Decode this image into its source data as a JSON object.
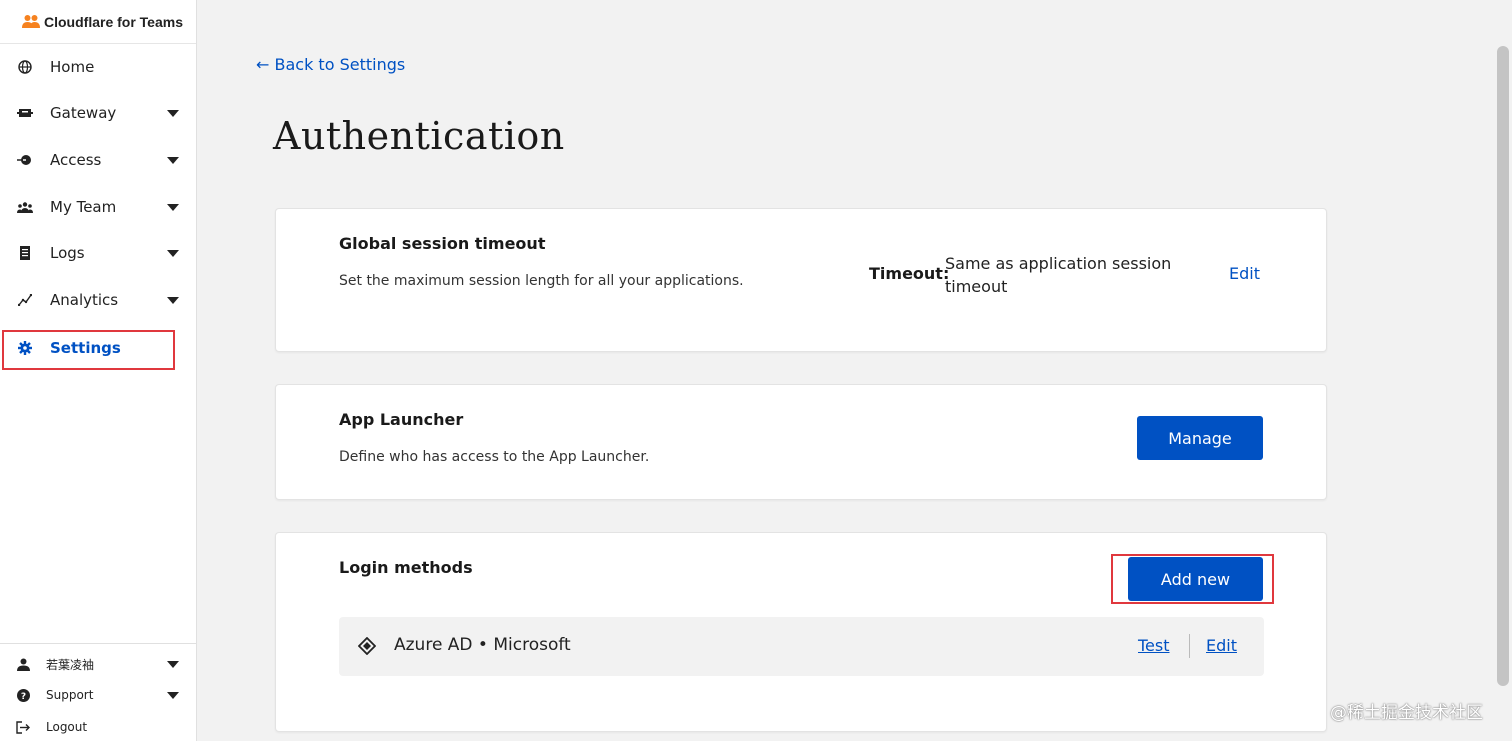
{
  "app": {
    "brand": "Cloudflare for Teams"
  },
  "sidebar": {
    "items": [
      {
        "label": "Home",
        "icon": "globe-icon",
        "has_caret": false
      },
      {
        "label": "Gateway",
        "icon": "gateway-icon",
        "has_caret": true
      },
      {
        "label": "Access",
        "icon": "access-icon",
        "has_caret": true
      },
      {
        "label": "My Team",
        "icon": "team-icon",
        "has_caret": true
      },
      {
        "label": "Logs",
        "icon": "logs-icon",
        "has_caret": true
      },
      {
        "label": "Analytics",
        "icon": "analytics-icon",
        "has_caret": true
      },
      {
        "label": "Settings",
        "icon": "gear-icon",
        "has_caret": false,
        "active": true
      }
    ],
    "bottom": [
      {
        "label": "若葉凌袖",
        "icon": "user-icon",
        "has_caret": true
      },
      {
        "label": "Support",
        "icon": "help-icon",
        "has_caret": true
      },
      {
        "label": "Logout",
        "icon": "logout-icon",
        "has_caret": false
      }
    ]
  },
  "main": {
    "back_link": "← Back to Settings",
    "title": "Authentication",
    "session_timeout": {
      "title": "Global session timeout",
      "description": "Set the maximum session length for all your applications.",
      "timeout_label": "Timeout:",
      "timeout_value": "Same as application session timeout",
      "edit_label": "Edit"
    },
    "app_launcher": {
      "title": "App Launcher",
      "description": "Define who has access to the App Launcher.",
      "manage_label": "Manage"
    },
    "login_methods": {
      "title": "Login methods",
      "add_label": "Add new",
      "methods": [
        {
          "name": "Azure AD • Microsoft",
          "test_label": "Test",
          "edit_label": "Edit"
        }
      ]
    }
  },
  "watermark": "@稀土掘金技术社区",
  "colors": {
    "accent": "#0051c3",
    "highlight_box": "#e0383e",
    "background": "#f2f2f2"
  }
}
